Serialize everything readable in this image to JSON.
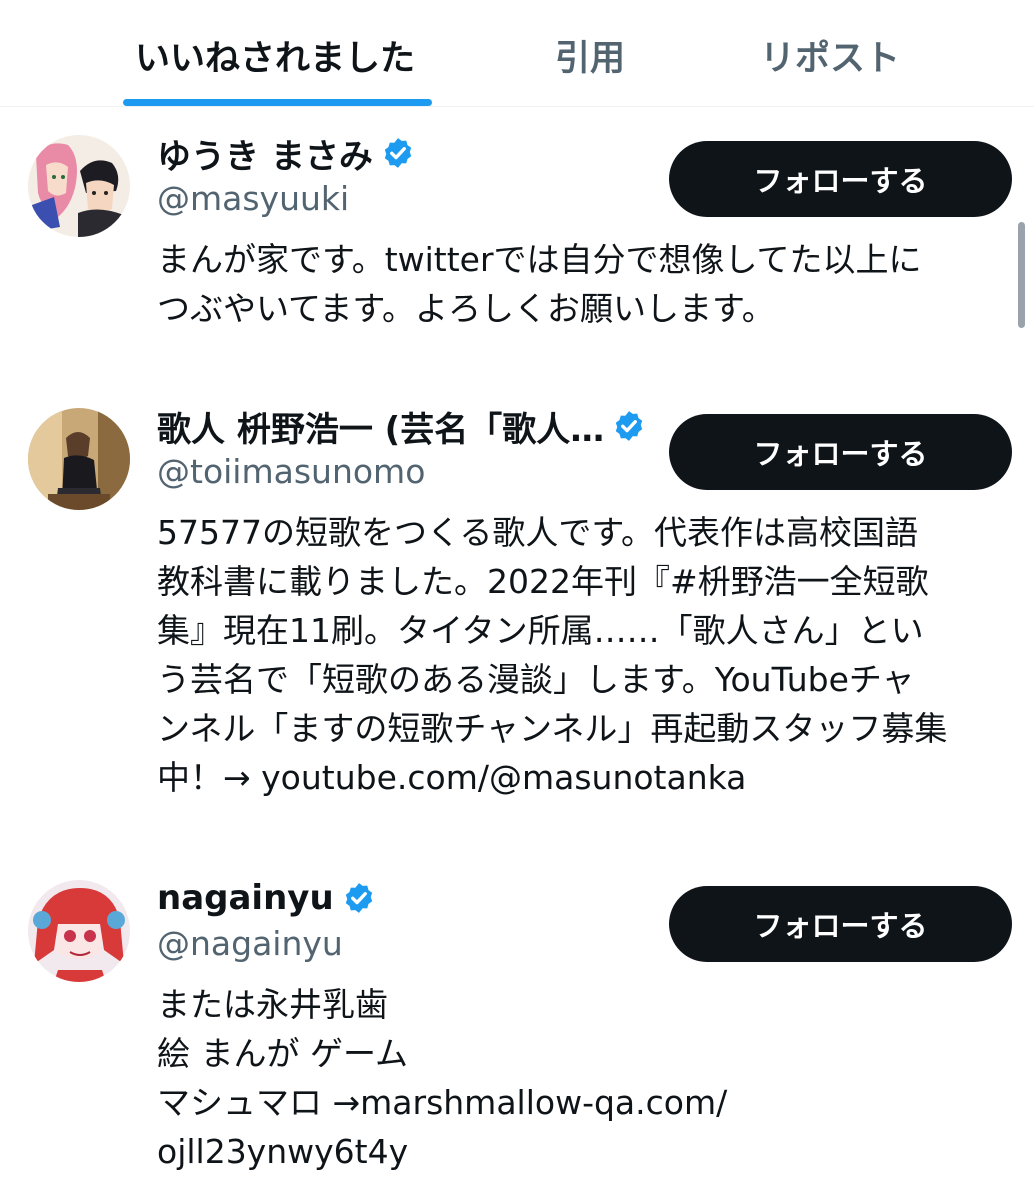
{
  "tabs": [
    {
      "label": "いいねされました",
      "active": true
    },
    {
      "label": "引用",
      "active": false
    },
    {
      "label": "リポスト",
      "active": false
    }
  ],
  "colors": {
    "accent": "#1d9bf0",
    "text_primary": "#0f1419",
    "text_secondary": "#536471",
    "button_bg": "#0f1419",
    "button_text": "#ffffff"
  },
  "users": [
    {
      "name": "ゆうき まさみ",
      "verified": true,
      "handle": "@masyuuki",
      "follow_label": "フォローする",
      "bio_lines": [
        "まんが家です。twitterでは自分で想像してた以上に",
        "つぶやいてます。よろしくお願いします。"
      ]
    },
    {
      "name": "歌人 枡野浩一 (芸名「歌人…",
      "verified": true,
      "handle": "@toiimasunomo",
      "follow_label": "フォローする",
      "bio_lines": [
        "57577の短歌をつくる歌人です。代表作は高校国語",
        "教科書に載りました。2022年刊『#枡野浩一全短歌",
        "集』現在11刷。タイタン所属……「歌人さん」とい",
        "う芸名で「短歌のある漫談」します。YouTubeチャ",
        "ンネル「ますの短歌チャンネル」再起動スタッフ募集",
        "中！→ youtube.com/@masunotanka"
      ]
    },
    {
      "name": "nagainyu",
      "verified": true,
      "handle": "@nagainyu",
      "follow_label": "フォローする",
      "bio_lines": [
        "または永井乳歯",
        "絵 まんが ゲーム",
        "マシュマロ →marshmallow-qa.com/",
        "ojll23ynwy6t4y"
      ]
    }
  ],
  "icons": {
    "verified": "verified-badge-icon"
  }
}
